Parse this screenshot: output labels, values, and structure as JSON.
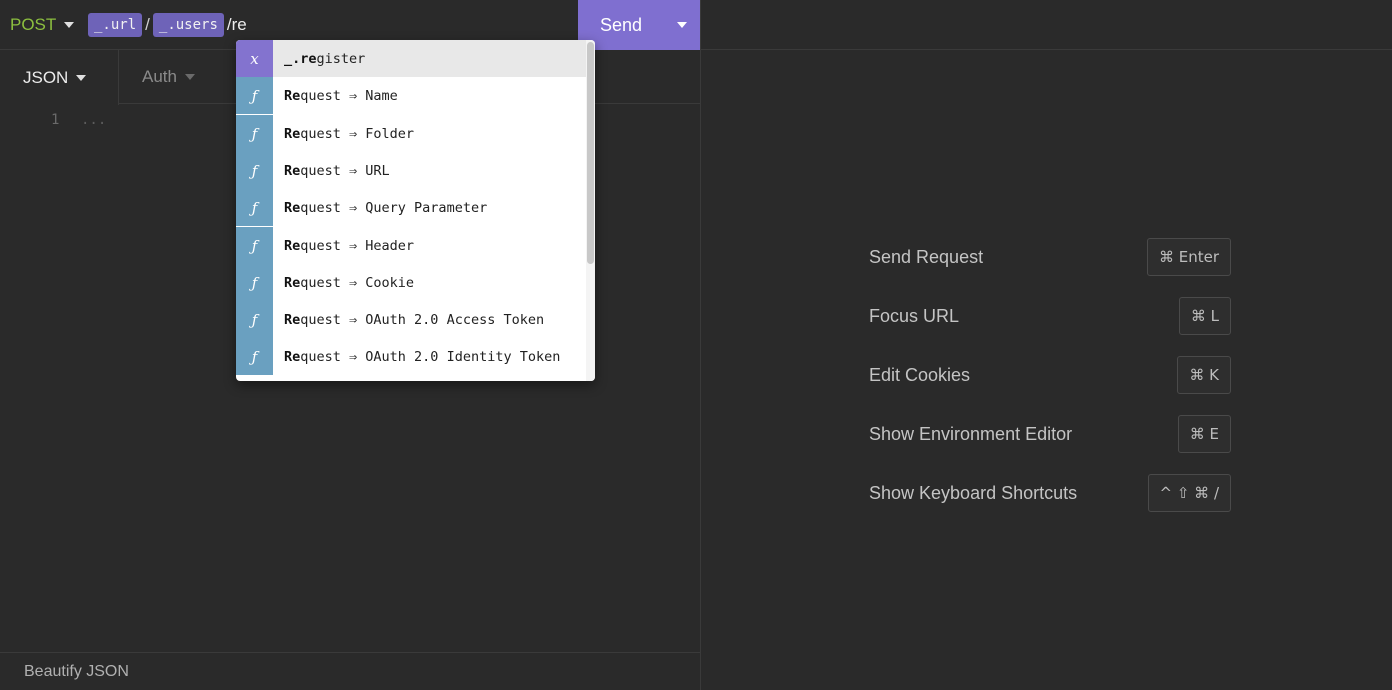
{
  "request": {
    "method": "POST",
    "url_tags": [
      "_.url",
      "_.users"
    ],
    "url_separator": "/",
    "url_typed": "/re",
    "send_label": "Send"
  },
  "tabs": {
    "body": "JSON",
    "auth": "Auth"
  },
  "editor": {
    "line_number": "1",
    "placeholder": "..."
  },
  "footer": {
    "beautify": "Beautify JSON"
  },
  "autocomplete": {
    "items": [
      {
        "kind": "var",
        "badge": "x",
        "match": "_.re",
        "rest": "gister"
      },
      {
        "kind": "fn",
        "badge": "ƒ",
        "match": "Re",
        "rest": "quest ⇒ Name"
      },
      {
        "kind": "fn",
        "badge": "ƒ",
        "match": "Re",
        "rest": "quest ⇒ Folder"
      },
      {
        "kind": "fn",
        "badge": "ƒ",
        "match": "Re",
        "rest": "quest ⇒ URL"
      },
      {
        "kind": "fn",
        "badge": "ƒ",
        "match": "Re",
        "rest": "quest ⇒ Query Parameter"
      },
      {
        "kind": "fn",
        "badge": "ƒ",
        "match": "Re",
        "rest": "quest ⇒ Header"
      },
      {
        "kind": "fn",
        "badge": "ƒ",
        "match": "Re",
        "rest": "quest ⇒ Cookie"
      },
      {
        "kind": "fn",
        "badge": "ƒ",
        "match": "Re",
        "rest": "quest ⇒ OAuth 2.0 Access Token"
      },
      {
        "kind": "fn",
        "badge": "ƒ",
        "match": "Re",
        "rest": "quest ⇒ OAuth 2.0 Identity Token"
      }
    ]
  },
  "shortcuts": [
    {
      "label": "Send Request",
      "keys": "⌘ Enter"
    },
    {
      "label": "Focus URL",
      "keys": "⌘ L"
    },
    {
      "label": "Edit Cookies",
      "keys": "⌘ K"
    },
    {
      "label": "Show Environment Editor",
      "keys": "⌘ E"
    },
    {
      "label": "Show Keyboard Shortcuts",
      "keys": "^ ⇧ ⌘ /"
    }
  ],
  "colors": {
    "accent": "#7f6fd0",
    "method_post": "#8cbf3f",
    "variable_badge": "#8373cf",
    "function_badge": "#6aa0c0",
    "tag": "#6e63b8"
  }
}
